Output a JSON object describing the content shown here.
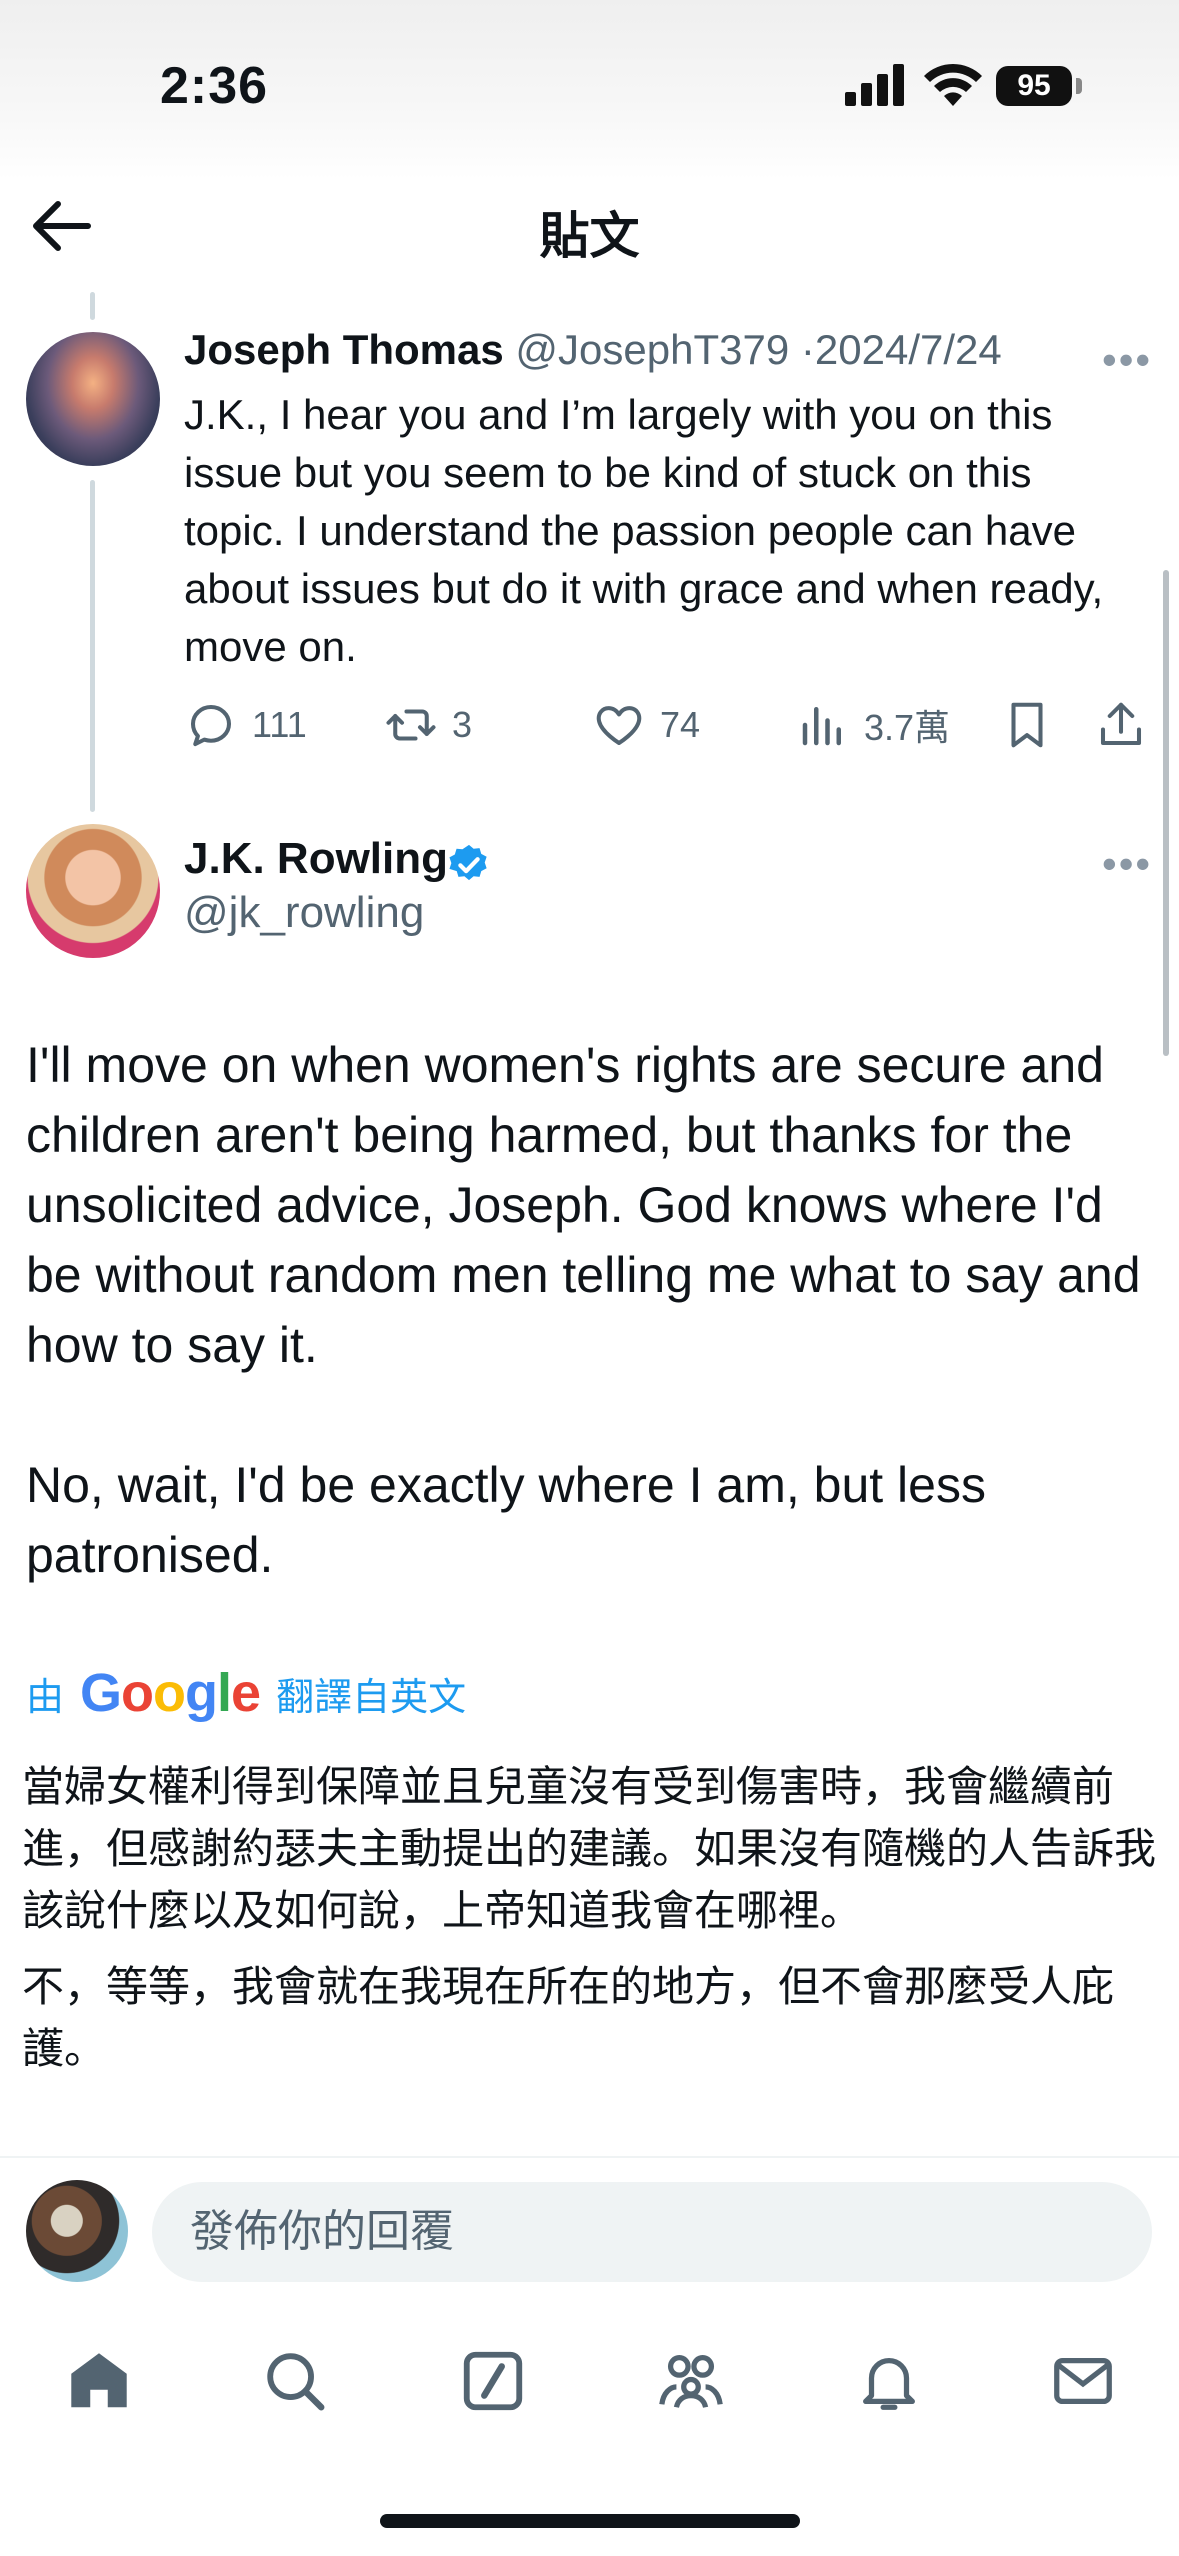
{
  "status": {
    "time": "2:36",
    "battery": "95",
    "icons": [
      "cellular-signal-icon",
      "wifi-icon",
      "battery-icon"
    ]
  },
  "nav": {
    "title": "貼文",
    "back_icon": "back-arrow-icon"
  },
  "reply_tweet": {
    "name": "Joseph Thomas",
    "handle": "@JosephT379",
    "separator": "·",
    "date": "2024/7/24",
    "text": "J.K., I hear you and I’m largely with you on this issue but you seem to be kind of stuck on this topic. I understand the passion people can have about issues but do it with grace and when ready, move on.",
    "stats": {
      "replies": "111",
      "reposts": "3",
      "likes": "74",
      "views": "3.7萬"
    }
  },
  "main_tweet": {
    "name": "J.K. Rowling",
    "handle": "@jk_rowling",
    "verified": true,
    "paragraph1": "I'll move on when women's rights are secure and children aren't being harmed, but thanks for the unsolicited advice, Joseph. God knows where I'd be without random men telling me what to say and how to say it.",
    "paragraph2": "No, wait, I'd be exactly where I am, but less patronised.",
    "translation_prefix": "由",
    "translation_brand": "Google",
    "translation_suffix": "翻譯自英文",
    "translated1": "當婦女權利得到保障並且兒童沒有受到傷害時，我會繼續前進，但感謝約瑟夫主動提出的建議。如果沒有隨機的人告訴我該說什麼以及如何說，上帝知道我會在哪裡。",
    "translated2": "不，等等，我會就在我現在所在的地方，但不會那麼受人庇護。"
  },
  "reply_input": {
    "placeholder": "發佈你的回覆"
  },
  "tabs": [
    "home-icon",
    "search-icon",
    "compose-icon",
    "communities-icon",
    "notifications-icon",
    "messages-icon"
  ],
  "colors": {
    "accent": "#1d9bf0",
    "text": "#0f1419",
    "secondary": "#536471"
  }
}
